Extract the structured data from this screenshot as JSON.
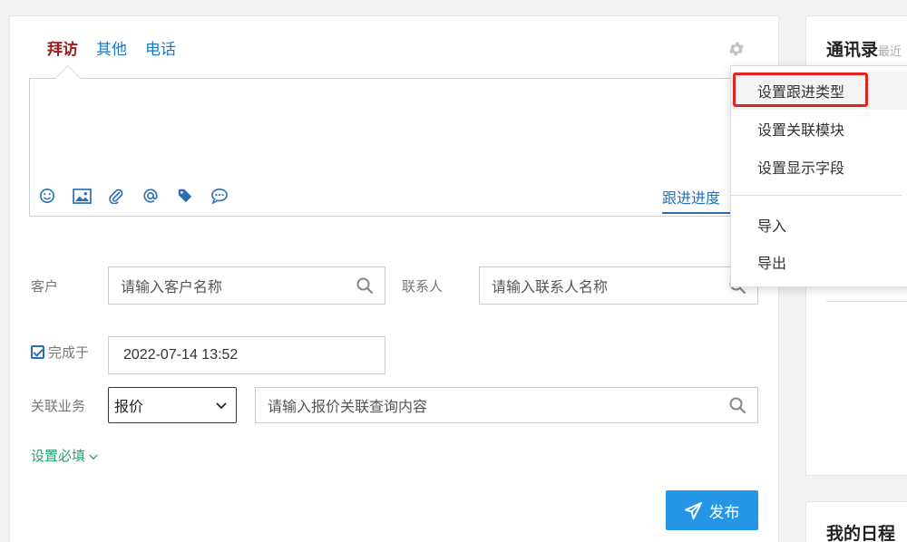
{
  "tabs": [
    {
      "label": "拜访",
      "active": true
    },
    {
      "label": "其他",
      "active": false
    },
    {
      "label": "电话",
      "active": false
    }
  ],
  "editor": {
    "toolbar_icons": [
      "smile-icon",
      "image-icon",
      "paperclip-icon",
      "at-icon",
      "tag-icon",
      "comment-icon"
    ],
    "progress_link": "跟进进度"
  },
  "form": {
    "customer_label": "客户",
    "customer_placeholder": "请输入客户名称",
    "contact_label": "联系人",
    "contact_placeholder": "请输入联系人名称",
    "completed_label": "完成于",
    "completed_checked": true,
    "completed_value": "2022-07-14 13:52",
    "related_label": "关联业务",
    "related_select": "报价",
    "related_placeholder": "请输入报价关联查询内容",
    "required_link": "设置必填",
    "publish_label": "发布"
  },
  "side": {
    "contacts_title": "通讯录",
    "contacts_sub": "最近",
    "schedule_title": "我的日程"
  },
  "dropdown": {
    "items": [
      "设置跟进类型",
      "设置关联模块",
      "设置显示字段",
      "导入",
      "导出"
    ]
  },
  "colors": {
    "accent": "#2596e6",
    "tab_active": "#9b1c1c",
    "link": "#2a6fb5",
    "highlight_box": "#e0241e",
    "required_link": "#2a9d6e"
  }
}
